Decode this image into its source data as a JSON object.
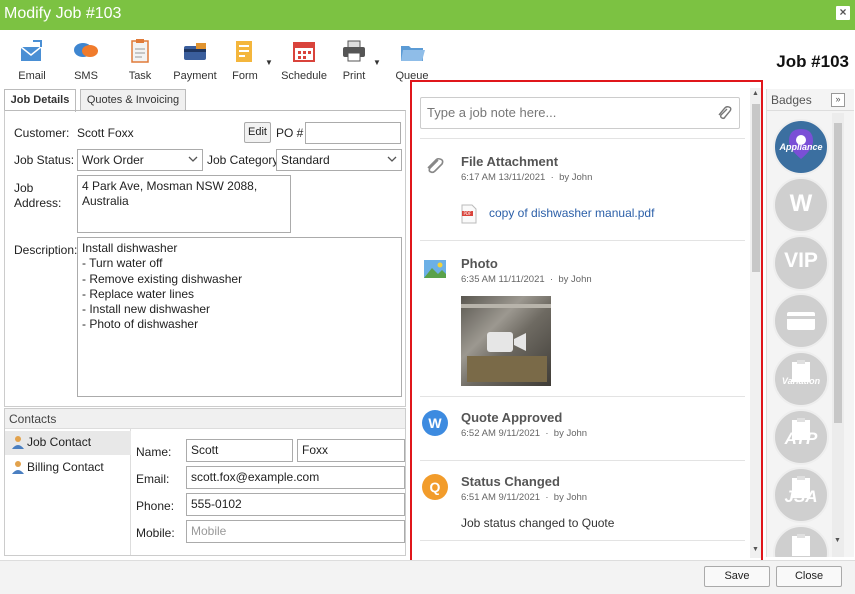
{
  "window": {
    "title": "Modify Job #103",
    "close_glyph": "×"
  },
  "job_title": "Job #103",
  "toolbar": [
    {
      "label": "Email",
      "icon": "email-icon"
    },
    {
      "label": "SMS",
      "icon": "sms-icon"
    },
    {
      "label": "Task",
      "icon": "task-icon"
    },
    {
      "label": "Payment",
      "icon": "payment-icon"
    },
    {
      "label": "Form",
      "icon": "form-icon"
    },
    {
      "label": "Schedule",
      "icon": "schedule-icon"
    },
    {
      "label": "Print",
      "icon": "print-icon"
    },
    {
      "label": "Queue",
      "icon": "queue-icon"
    }
  ],
  "tabs": [
    {
      "label": "Job Details"
    },
    {
      "label": "Quotes & Invoicing"
    }
  ],
  "details": {
    "customer_label": "Customer:",
    "customer_value": "Scott Foxx",
    "edit_label": "Edit",
    "po_label": "PO #",
    "po_value": "",
    "status_label": "Job Status:",
    "status_value": "Work Order",
    "category_label": "Job Category",
    "category_value": "Standard",
    "address_label": "Job\nAddress:",
    "address_value": "4 Park Ave, Mosman NSW 2088,\nAustralia",
    "description_label": "Description:",
    "description_value": "Install dishwasher\n- Turn water off\n- Remove existing dishwasher\n- Replace water lines\n- Install new dishwasher\n- Photo of dishwasher"
  },
  "contacts": {
    "header": "Contacts",
    "items": [
      {
        "label": "Job Contact"
      },
      {
        "label": "Billing Contact"
      }
    ],
    "name_label": "Name:",
    "first_name": "Scott",
    "last_name": "Foxx",
    "email_label": "Email:",
    "email_value": "scott.fox@example.com",
    "phone_label": "Phone:",
    "phone_value": "555-0102",
    "mobile_label": "Mobile:",
    "mobile_placeholder": "Mobile"
  },
  "notes": {
    "placeholder": "Type a job note here...",
    "entries": [
      {
        "title": "File Attachment",
        "time": "6:17 AM 13/11/2021",
        "by": "by John",
        "attachment": "copy of dishwasher manual.pdf"
      },
      {
        "title": "Photo",
        "time": "6:35 AM 11/11/2021",
        "by": "by John"
      },
      {
        "title": "Quote Approved",
        "time": "6:52 AM 9/11/2021",
        "by": "by John",
        "avatar": "W",
        "avatar_color": "#3d8be0"
      },
      {
        "title": "Status Changed",
        "time": "6:51 AM 9/11/2021",
        "by": "by John",
        "avatar": "Q",
        "avatar_color": "#f29c2b",
        "body": "Job status changed to Quote"
      }
    ]
  },
  "badges": {
    "header": "Badges",
    "toggle": "»",
    "items": [
      {
        "label": "Appliance",
        "color": "#7a4fd6"
      },
      {
        "label": "W"
      },
      {
        "label": "VIP"
      },
      {
        "label": ""
      },
      {
        "label": "Variation"
      },
      {
        "label": "ATP"
      },
      {
        "label": "JSA"
      },
      {
        "label": ""
      }
    ]
  },
  "footer": {
    "save_label": "Save",
    "close_label": "Close"
  }
}
